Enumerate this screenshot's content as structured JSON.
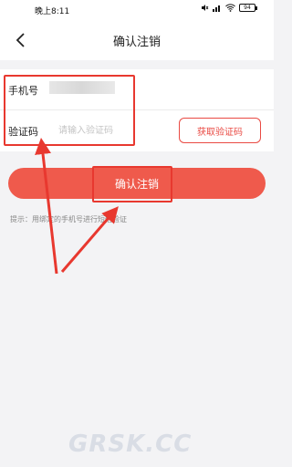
{
  "status_bar": {
    "time": "晚上8:11",
    "battery": "94"
  },
  "header": {
    "title": "确认注销"
  },
  "form": {
    "phone_label": "手机号",
    "code_label": "验证码",
    "code_placeholder": "请输入验证码",
    "get_code_label": "获取验证码"
  },
  "confirm_label": "确认注销",
  "hint": "提示：用绑定的手机号进行短信验证",
  "watermark": "GRSK.CC",
  "colors": {
    "accent": "#ef5a4c",
    "annotation": "#e8382f"
  }
}
